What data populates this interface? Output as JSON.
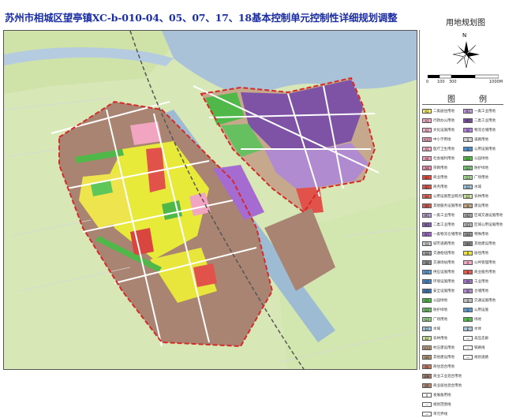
{
  "title": "苏州市相城区望亭镇XC-b-010-04、05、07、17、18基本控制单元控制性详细规划调整",
  "subtitle": "用地规划图",
  "colors": {
    "title": "#1a2da3",
    "river": "#9fb8cf",
    "residential_yellow": "#e8ea3a",
    "industrial_purple": "#7e53a5",
    "industrial_light": "#b18bd0",
    "commercial_red": "#e0524a",
    "education_pink": "#f2a5c0",
    "green_space": "#4fb848",
    "farmland": "#cfe6a4",
    "mixed_brown": "#a98472",
    "boundary_red": "#d42a2a"
  },
  "compass": {
    "north_label": "N"
  },
  "scale": {
    "labels": [
      "0",
      "100",
      "300",
      "1000M"
    ]
  },
  "legend": {
    "title_chars": [
      "图",
      "例"
    ],
    "left": [
      {
        "code": "R2",
        "color": "#f7ef6a",
        "label": "二类居住用地"
      },
      {
        "code": "A1",
        "color": "#f0a8c4",
        "label": "行政办公用地"
      },
      {
        "code": "A2",
        "color": "#f5b6cd",
        "label": "文化设施用地"
      },
      {
        "code": "A33",
        "color": "#f4a5c0",
        "label": "中小学用地"
      },
      {
        "code": "A5",
        "color": "#f6b0c8",
        "label": "医疗卫生用地"
      },
      {
        "code": "A6",
        "color": "#f3a0bb",
        "label": "社会福利用地"
      },
      {
        "code": "A9",
        "color": "#ec8fb0",
        "label": "宗教用地"
      },
      {
        "code": "B1",
        "color": "#e84a3e",
        "label": "商业用地"
      },
      {
        "code": "B2",
        "color": "#e0584c",
        "label": "商务用地"
      },
      {
        "code": "B4",
        "color": "#e76c5a",
        "label": "公用设施营业网点用地"
      },
      {
        "code": "B9",
        "color": "#d96055",
        "label": "其他服务设施用地"
      },
      {
        "code": "M1",
        "color": "#b7a0cf",
        "label": "一类工业用地"
      },
      {
        "code": "M2",
        "color": "#8a67b3",
        "label": "二类工业用地"
      },
      {
        "code": "W1",
        "color": "#a56bd1",
        "label": "一类物流仓储用地"
      },
      {
        "code": "S1",
        "color": "#c9c9c9",
        "label": "城市道路用地"
      },
      {
        "code": "S3",
        "color": "#a2a2a2",
        "label": "交通枢纽用地"
      },
      {
        "code": "S4",
        "color": "#8e8e8e",
        "label": "交通场站用地"
      },
      {
        "code": "U1",
        "color": "#5d9ad1",
        "label": "供应设施用地"
      },
      {
        "code": "U2",
        "color": "#4a86c2",
        "label": "环境设施用地"
      },
      {
        "code": "U3",
        "color": "#3d77b4",
        "label": "安全设施用地"
      },
      {
        "code": "G1",
        "color": "#4fb848",
        "label": "公园绿地"
      },
      {
        "code": "G2",
        "color": "#6fc06a",
        "label": "防护绿地"
      },
      {
        "code": "G3",
        "color": "#9bd18a",
        "label": "广场用地"
      },
      {
        "code": "E1",
        "color": "#9fc4dc",
        "label": "水域"
      },
      {
        "code": "E2",
        "color": "#cfe6a4",
        "label": "农林用地"
      },
      {
        "code": "H14",
        "color": "#c4a884",
        "label": "村庄建设用地"
      },
      {
        "code": "H9",
        "color": "#b79a78",
        "label": "其他建设用地"
      },
      {
        "code": "Rb",
        "color": "#c77f6a",
        "label": "商住混合用地"
      },
      {
        "code": "BM",
        "color": "#a98472",
        "label": "商业工业混合用地"
      },
      {
        "code": "BR",
        "color": "#b88e7a",
        "label": "商业居住混合用地"
      },
      {
        "code": "X",
        "color": "#ffffff",
        "label": "发展备用地"
      },
      {
        "code": "—",
        "color": "#ffffff",
        "label": "规划范围线"
      },
      {
        "code": "—",
        "color": "#ffffff",
        "label": "单元界线"
      }
    ],
    "right": [
      {
        "code": "M1",
        "color": "#c39de0",
        "label": "一类工业用地"
      },
      {
        "code": "M2",
        "color": "#7e53a5",
        "label": "二类工业用地"
      },
      {
        "code": "W",
        "color": "#b583e0",
        "label": "物流仓储用地"
      },
      {
        "code": "S",
        "color": "#d4d4d4",
        "label": "道路用地"
      },
      {
        "code": "U",
        "color": "#4b8fcf",
        "label": "公用设施用地"
      },
      {
        "code": "G1",
        "color": "#55bd4c",
        "label": "公园绿地"
      },
      {
        "code": "G2",
        "color": "#7dc977",
        "label": "防护绿地"
      },
      {
        "code": "G3",
        "color": "#a8dd98",
        "label": "广场用地"
      },
      {
        "code": "E1",
        "color": "#9fc4dc",
        "label": "水域"
      },
      {
        "code": "E2",
        "color": "#cfe6a4",
        "label": "农林用地"
      },
      {
        "code": "H",
        "color": "#c2a382",
        "label": "建设用地"
      },
      {
        "code": "H2",
        "color": "#a9a9a9",
        "label": "区域交通设施用地"
      },
      {
        "code": "H3",
        "color": "#bbbbbb",
        "label": "区域公用设施用地"
      },
      {
        "code": "H4",
        "color": "#999999",
        "label": "特殊用地"
      },
      {
        "code": "H9",
        "color": "#8a8a8a",
        "label": "其他建设用地"
      },
      {
        "code": "R",
        "color": "#ede44a",
        "label": "居住用地"
      },
      {
        "code": "A",
        "color": "#f0aac3",
        "label": "公共管理用地"
      },
      {
        "code": "B",
        "color": "#e25b4f",
        "label": "商业服务用地"
      },
      {
        "code": "M",
        "color": "#9c78c0",
        "label": "工业用地"
      },
      {
        "code": "W",
        "color": "#b38ed3",
        "label": "仓储用地"
      },
      {
        "code": "S",
        "color": "#bfbfbf",
        "label": "交通设施用地"
      },
      {
        "code": "U",
        "color": "#6098c9",
        "label": "公用设施"
      },
      {
        "code": "G",
        "color": "#59bc50",
        "label": "绿地"
      },
      {
        "code": "E",
        "color": "#a8c7db",
        "label": "水体"
      },
      {
        "code": "—",
        "color": "#ffffff",
        "label": "高压走廊"
      },
      {
        "code": "—",
        "color": "#ffffff",
        "label": "铁路线"
      },
      {
        "code": "—",
        "color": "#ffffff",
        "label": "规划道路"
      }
    ]
  }
}
